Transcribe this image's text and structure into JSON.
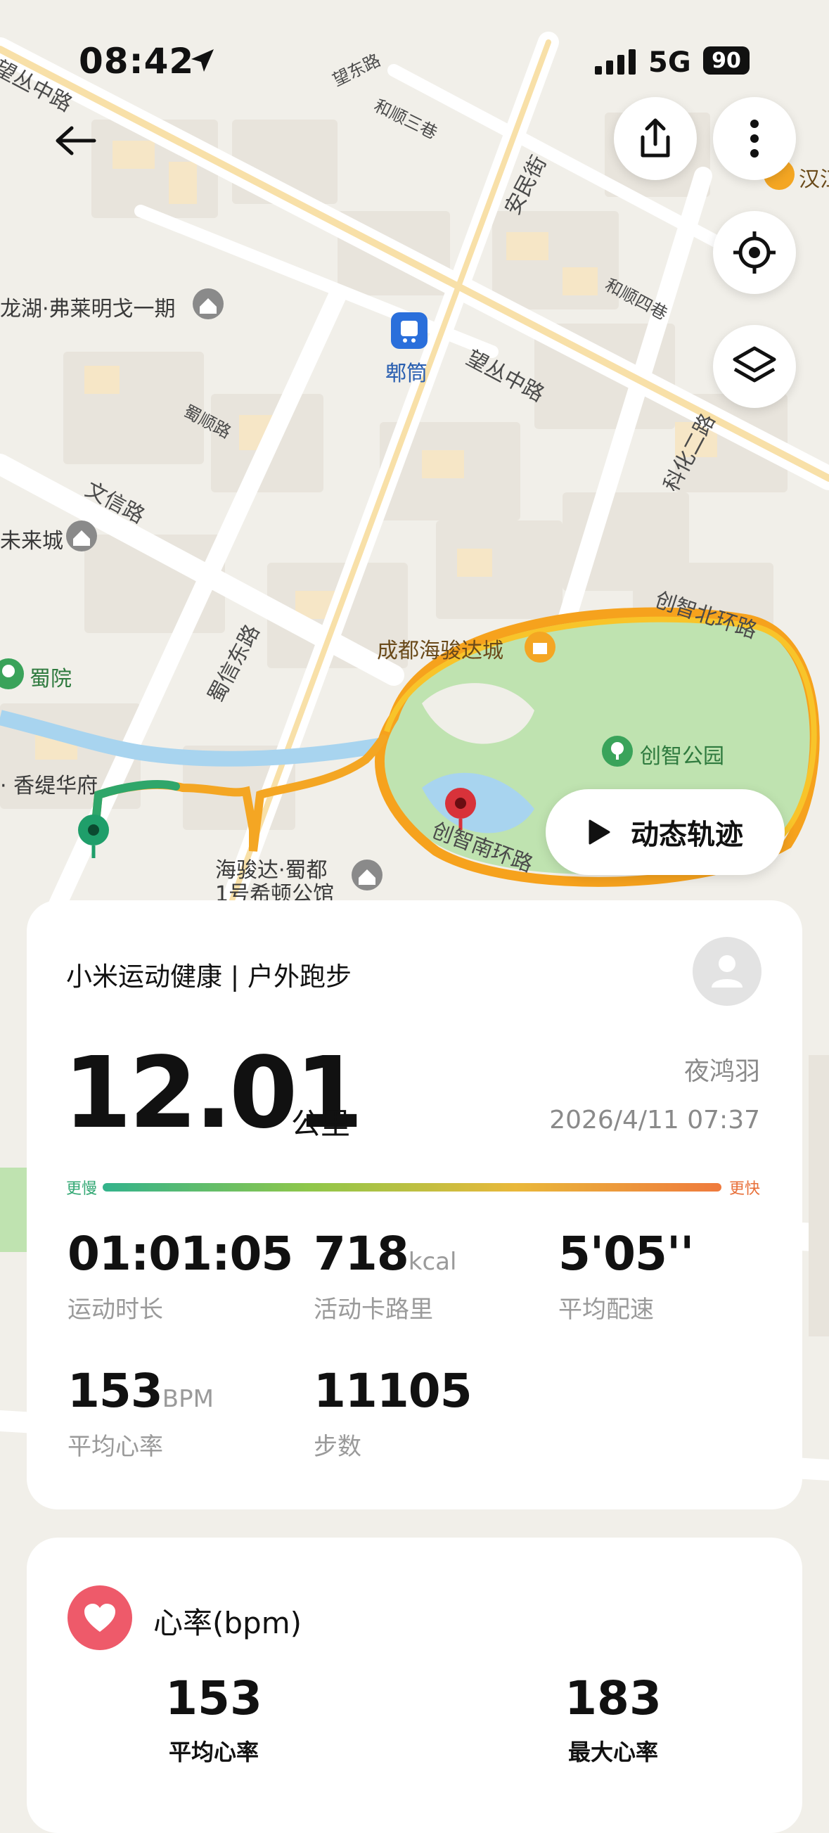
{
  "status_bar": {
    "time": "08:42",
    "network": "5G",
    "battery": "90"
  },
  "map": {
    "labels": {
      "wangcong_nw": "望丛中路",
      "wangdong": "望东路",
      "heshun3": "和顺三巷",
      "anmin": "安民街",
      "hanji": "汉江",
      "heshun4": "和顺四巷",
      "fulai": "龙湖·弗莱明戈一期",
      "pitong": "郫筒",
      "wangcong_mid": "望丛中路",
      "kehua": "科化二路",
      "shushun": "蜀顺路",
      "wenxin": "文信路",
      "weilai": "未来城",
      "shuxin": "蜀信东路",
      "haijun": "成都海骏达城",
      "chuangzhi_n": "创智北环路",
      "shuyuan": "蜀院",
      "chuangzhi_park": "创智公园",
      "xiangti": "香缇华府",
      "chuangzhi_s": "创智南环路",
      "hilton_1": "海骏达·蜀都",
      "hilton_2": "1号希顿公馆"
    },
    "play_label": "动态轨迹"
  },
  "summary": {
    "source": "小米运动健康 | 户外跑步",
    "distance": "12.01",
    "distance_unit": "公里",
    "user": "夜鸿羽",
    "datetime": "2026/4/11 07:37",
    "pace_slow": "更慢",
    "pace_fast": "更快",
    "stats": [
      {
        "value": "01:01:05",
        "unit": "",
        "label": "运动时长"
      },
      {
        "value": "718",
        "unit": "kcal",
        "label": "活动卡路里"
      },
      {
        "value": "5'05''",
        "unit": "",
        "label": "平均配速"
      },
      {
        "value": "153",
        "unit": "BPM",
        "label": "平均心率"
      },
      {
        "value": "11105",
        "unit": "",
        "label": "步数"
      }
    ]
  },
  "heart_rate": {
    "title": "心率(bpm)",
    "avg_value": "153",
    "avg_label": "平均心率",
    "max_value": "183",
    "max_label": "最大心率"
  },
  "colors": {
    "route_start": "#1f9e6a",
    "route_end": "#f4a623",
    "end_pin": "#d8323a",
    "heart": "#ee5a6a"
  }
}
